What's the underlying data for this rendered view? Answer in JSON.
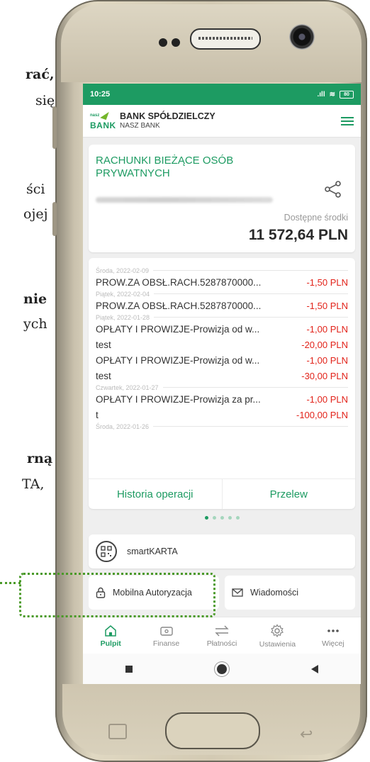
{
  "doc_fragments": [
    {
      "text": "rać,",
      "bold": true
    },
    {
      "text": "się",
      "bold": false
    },
    {
      "text": "ści",
      "bold": false
    },
    {
      "text": "ojej",
      "bold": false
    },
    {
      "text": "nie",
      "bold": true
    },
    {
      "text": "ych",
      "bold": false
    },
    {
      "text": "rną",
      "bold": true
    },
    {
      "text": "TA,",
      "bold": false
    }
  ],
  "status_bar": {
    "time": "10:25",
    "signal": ".ıll",
    "battery": "80"
  },
  "header": {
    "logo_top": "nasz",
    "logo_bottom": "BANK",
    "bank_line1": "BANK SPÓŁDZIELCZY",
    "bank_line2": "NASZ BANK"
  },
  "account": {
    "title": "RACHUNKI BIEŻĄCE OSÓB PRYWATNYCH",
    "available_label": "Dostępne środki",
    "balance": "11 572,64 PLN"
  },
  "transactions": {
    "date_groups": [
      "Środa, 2022-02-09",
      "Piątek, 2022-02-04",
      "Piątek, 2022-01-28",
      "Czwartek, 2022-01-27",
      "Środa, 2022-01-26"
    ],
    "items": [
      {
        "desc": "PROW.ZA OBSŁ.RACH.5287870000...",
        "amount": "-1,50 PLN"
      },
      {
        "desc": "PROW.ZA OBSŁ.RACH.5287870000...",
        "amount": "-1,50 PLN"
      },
      {
        "desc": "OPŁATY I PROWIZJE-Prowizja od w...",
        "amount": "-1,00 PLN"
      },
      {
        "desc": "test",
        "amount": "-20,00 PLN"
      },
      {
        "desc": "OPŁATY I PROWIZJE-Prowizja od w...",
        "amount": "-1,00 PLN"
      },
      {
        "desc": "test",
        "amount": "-30,00 PLN"
      },
      {
        "desc": "OPŁATY I PROWIZJE-Prowizja za pr...",
        "amount": "-1,00 PLN"
      },
      {
        "desc": "t",
        "amount": "-100,00 PLN"
      }
    ]
  },
  "actions": {
    "history": "Historia operacji",
    "transfer": "Przelew"
  },
  "pager": {
    "count": 5,
    "active": 0
  },
  "smartkarta": {
    "label": "smartKARTA"
  },
  "quick": {
    "auth": "Mobilna Autoryzacja",
    "messages": "Wiadomości"
  },
  "tabs": [
    {
      "label": "Pulpit",
      "icon": "home-icon",
      "active": true
    },
    {
      "label": "Finanse",
      "icon": "wallet-icon",
      "active": false
    },
    {
      "label": "Płatności",
      "icon": "transfer-arrows-icon",
      "active": false
    },
    {
      "label": "Ustawienia",
      "icon": "gear-icon",
      "active": false
    },
    {
      "label": "Więcej",
      "icon": "more-dots-icon",
      "active": false
    }
  ],
  "colors": {
    "brand_green": "#1d9b62",
    "amount_red": "#e2231a",
    "highlight_green": "#4a9a28"
  }
}
